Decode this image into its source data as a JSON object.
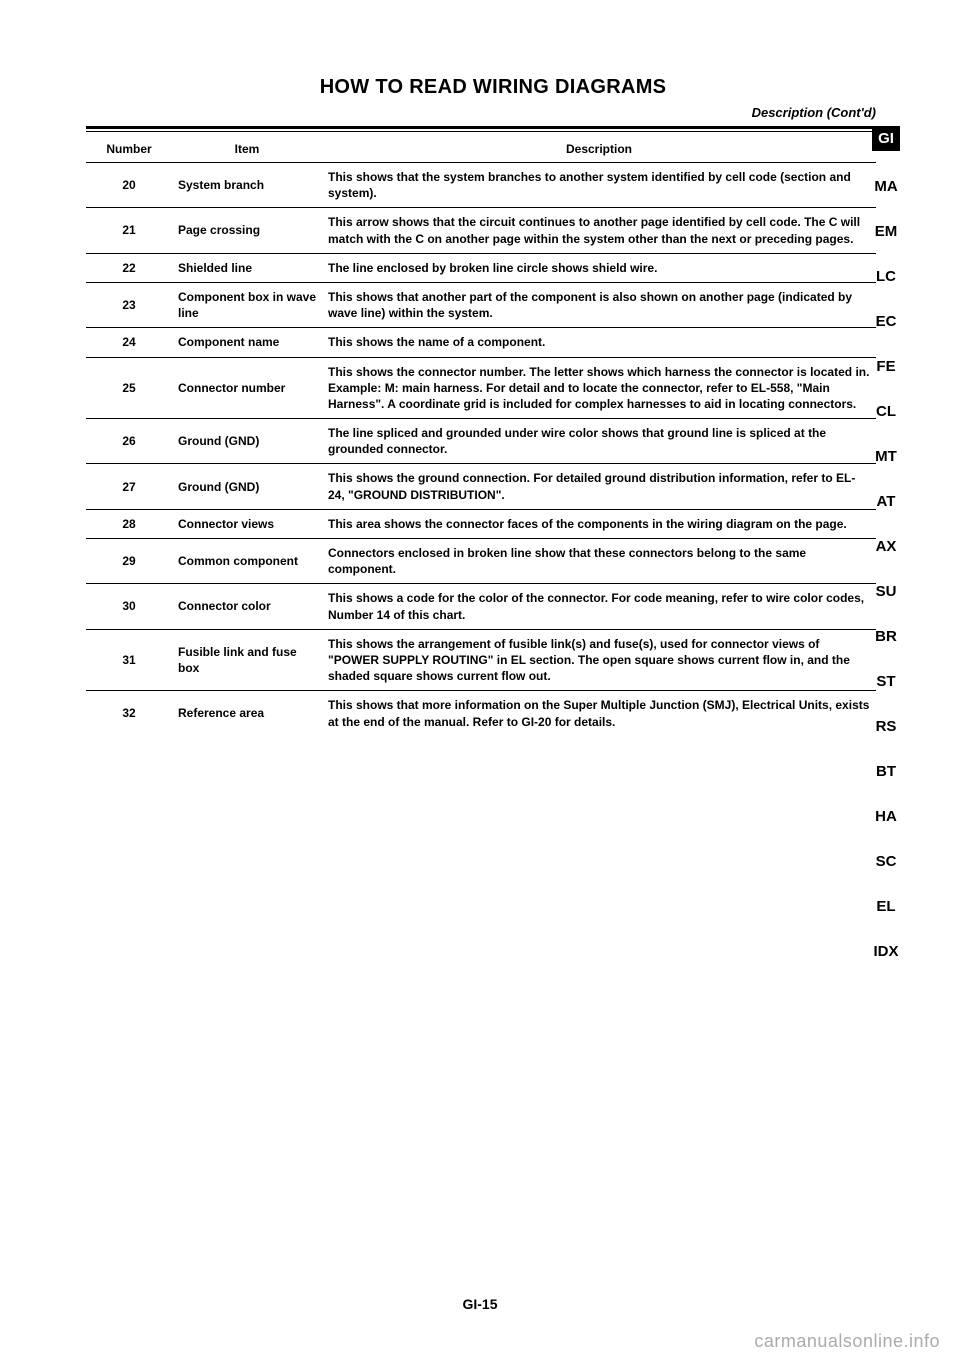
{
  "header": {
    "title": "HOW TO READ WIRING DIAGRAMS",
    "subtitle": "Description (Cont'd)"
  },
  "table": {
    "headers": {
      "number": "Number",
      "item": "Item",
      "description": "Description"
    },
    "rows": [
      {
        "number": "20",
        "item": "System branch",
        "description": "This shows that the system branches to another system identified by cell code (section and system)."
      },
      {
        "number": "21",
        "item": "Page crossing",
        "description": "This arrow shows that the circuit continues to another page identified by cell code. The C will match with the C on another page within the system other than the next or preceding pages."
      },
      {
        "number": "22",
        "item": "Shielded line",
        "description": "The line enclosed by broken line circle shows shield wire."
      },
      {
        "number": "23",
        "item": "Component box in wave line",
        "description": "This shows that another part of the component is also shown on another page (indicated by wave line) within the system."
      },
      {
        "number": "24",
        "item": "Component name",
        "description": "This shows the name of a component."
      },
      {
        "number": "25",
        "item": "Connector number",
        "description": "This shows the connector number. The letter shows which harness the connector is located in. Example: M: main harness. For detail and to locate the connector, refer to EL-558, \"Main Harness\". A coordinate grid is included for complex harnesses to aid in locating connectors."
      },
      {
        "number": "26",
        "item": "Ground (GND)",
        "description": "The line spliced and grounded under wire color shows that ground line is spliced at the grounded connector."
      },
      {
        "number": "27",
        "item": "Ground (GND)",
        "description": "This shows the ground connection. For detailed ground distribution information, refer to EL-24, \"GROUND DISTRIBUTION\"."
      },
      {
        "number": "28",
        "item": "Connector views",
        "description": "This area shows the connector faces of the components in the wiring diagram on the page."
      },
      {
        "number": "29",
        "item": "Common component",
        "description": "Connectors enclosed in broken line show that these connectors belong to the same component."
      },
      {
        "number": "30",
        "item": "Connector color",
        "description": "This shows a code for the color of the connector. For code meaning, refer to wire color codes, Number 14 of this chart."
      },
      {
        "number": "31",
        "item": "Fusible link and fuse box",
        "description": "This shows the arrangement of fusible link(s) and fuse(s), used for connector views of \"POWER SUPPLY ROUTING\" in EL section. The open square shows current flow in, and the shaded square shows current flow out."
      },
      {
        "number": "32",
        "item": "Reference area",
        "description": "This shows that more information on the Super Multiple Junction (SMJ), Electrical Units, exists at the end of the manual. Refer to GI-20 for details."
      }
    ]
  },
  "tabs": [
    "GI",
    "MA",
    "EM",
    "LC",
    "EC",
    "FE",
    "CL",
    "MT",
    "AT",
    "AX",
    "SU",
    "BR",
    "ST",
    "RS",
    "BT",
    "HA",
    "SC",
    "EL",
    "IDX"
  ],
  "active_tab": "GI",
  "page_number": "GI-15",
  "watermark": "carmanualsonline.info"
}
